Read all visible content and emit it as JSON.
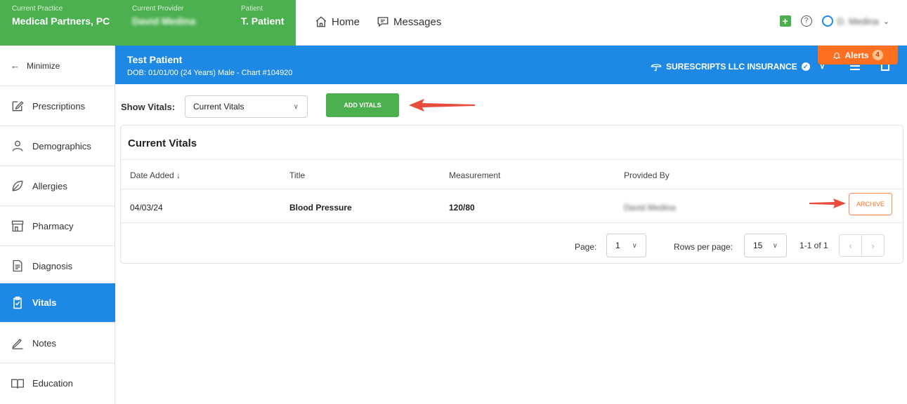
{
  "context": {
    "practice_label": "Current Practice",
    "practice_value": "Medical Partners, PC",
    "provider_label": "Current Provider",
    "provider_value": "David Medina",
    "patient_label": "Patient",
    "patient_value": "T. Patient"
  },
  "topnav": {
    "home": "Home",
    "messages": "Messages"
  },
  "user": {
    "name": "D. Medina",
    "caret": "⌄"
  },
  "sidebar": {
    "minimize": "Minimize",
    "items": [
      {
        "label": "Prescriptions",
        "icon": "edit-icon"
      },
      {
        "label": "Demographics",
        "icon": "person-icon"
      },
      {
        "label": "Allergies",
        "icon": "leaf-icon"
      },
      {
        "label": "Pharmacy",
        "icon": "store-icon"
      },
      {
        "label": "Diagnosis",
        "icon": "document-icon"
      },
      {
        "label": "Vitals",
        "icon": "clipboard-icon"
      },
      {
        "label": "Notes",
        "icon": "pencil-icon"
      },
      {
        "label": "Education",
        "icon": "book-icon"
      }
    ]
  },
  "patient": {
    "name": "Test Patient",
    "info": "DOB: 01/01/00 (24 Years) Male - Chart #104920",
    "insurance": "SURESCRIPTS LLC INSURANCE"
  },
  "alerts": {
    "label": "Alerts",
    "count": "4"
  },
  "vitals": {
    "show_label": "Show Vitals:",
    "selected": "Current Vitals",
    "add_button": "ADD VITALS",
    "card_title": "Current Vitals",
    "columns": [
      "Date Added ↓",
      "Title",
      "Measurement",
      "Provided By"
    ],
    "rows": [
      {
        "date": "04/03/24",
        "title": "Blood Pressure",
        "measurement": "120/80",
        "provided_by": "David Medina",
        "action": "ARCHIVE"
      }
    ],
    "pagination": {
      "page_label": "Page:",
      "page": "1",
      "rows_label": "Rows per page:",
      "rows_per_page": "15",
      "range": "1-1 of 1"
    }
  },
  "colors": {
    "green": "#4caf50",
    "blue": "#1e88e5",
    "orange": "#ff6f22",
    "arrow": "#e74c3c"
  }
}
